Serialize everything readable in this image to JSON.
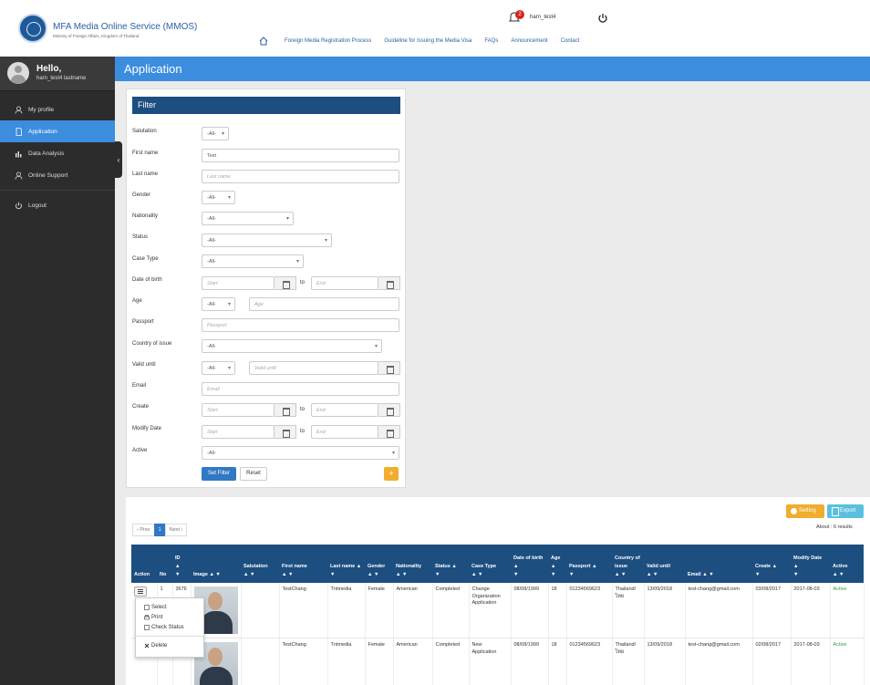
{
  "header": {
    "brand_title": "MFA Media Online Service (MMOS)",
    "brand_subtitle": "Ministry of Foreign Affairs, Kingdom of Thailand",
    "notification_count": "2",
    "username": "harn_test4",
    "nav": [
      "Foreign Media Registration Process",
      "Guideline for Issuing the Media Visa",
      "FAQs",
      "Announcement",
      "Contact"
    ]
  },
  "sidebar": {
    "hello": "Hello,",
    "user_fullname": "harn_test4 lastname",
    "items": [
      {
        "label": "My profile",
        "icon": "user-icon"
      },
      {
        "label": "Application",
        "icon": "document-icon"
      },
      {
        "label": "Data Analysis",
        "icon": "bar-chart-icon"
      },
      {
        "label": "Online Support",
        "icon": "support-icon"
      }
    ],
    "logout": "Logout"
  },
  "page_title": "Application",
  "filter": {
    "title": "Filter",
    "salutation": {
      "label": "Salutation",
      "value": "-All-"
    },
    "first_name": {
      "label": "First name",
      "value": "Test"
    },
    "last_name": {
      "label": "Last name",
      "placeholder": "Last name"
    },
    "gender": {
      "label": "Gender",
      "value": "-All-"
    },
    "nationality": {
      "label": "Nationality",
      "value": "-All-"
    },
    "status": {
      "label": "Status",
      "value": "-All-"
    },
    "case_type": {
      "label": "Case Type",
      "value": "-All-"
    },
    "dob": {
      "label": "Date of birth",
      "start": "Start",
      "to": "to",
      "end": "End"
    },
    "age": {
      "label": "Age",
      "op": "-All-",
      "placeholder": "Age"
    },
    "passport": {
      "label": "Passport",
      "placeholder": "Passport"
    },
    "country_issue": {
      "label": "Country of issue",
      "value": "-All-"
    },
    "valid_until": {
      "label": "Valid until",
      "op": "-All-",
      "placeholder": "Valid until"
    },
    "email": {
      "label": "Email",
      "placeholder": "Email"
    },
    "create": {
      "label": "Create",
      "start": "Start",
      "to": "to",
      "end": "End"
    },
    "modify_date": {
      "label": "Modify Date",
      "start": "Start",
      "to": "to",
      "end": "End"
    },
    "active": {
      "label": "Active",
      "value": "-All-"
    },
    "set_filter": "Set Filter",
    "reset": "Reset",
    "plus": "+"
  },
  "results": {
    "setting": "Setting",
    "export": "Export",
    "about": "About : 6 results",
    "pager": {
      "prev": "‹ Prev",
      "current": "1",
      "next": "Next ›"
    },
    "sort_marks": {
      "up": "▲",
      "down": "▼",
      "both": "▲ ▼"
    },
    "columns": {
      "action": "Action",
      "no": "No",
      "id": "ID",
      "image": "Image",
      "salutation": "Salutation",
      "first_name": "First name",
      "last_name": "Last name",
      "gender": "Gender",
      "nationality": "Nationality",
      "status": "Status",
      "case_type": "Case Type",
      "dob": "Date of birth",
      "age": "Age",
      "passport": "Passport",
      "country": "Country of issue",
      "valid_until": "Valid until",
      "email": "Email",
      "create": "Create",
      "modify": "Modify Date",
      "active": "Active"
    },
    "rows": [
      {
        "no": "1",
        "id": "3676",
        "salutation": "",
        "first_name": "TestChang",
        "last_name": "Tntmedia",
        "gender": "Female",
        "nationality": "American",
        "status": "Completed",
        "case_type": "Change Organization Application",
        "dob": "08/08/1999",
        "age": "18",
        "passport": "01234569623",
        "country": "Thailand/ ไทย",
        "valid_until": "13/09/2018",
        "email": "test-chang@gmail.com",
        "create": "03/08/2017",
        "modify": "2017-08-03",
        "active": "Active"
      },
      {
        "no": "",
        "id": "",
        "salutation": "",
        "first_name": "TestChang",
        "last_name": "Tntmedia",
        "gender": "Female",
        "nationality": "American",
        "status": "Completed",
        "case_type": "New Application",
        "dob": "08/08/1999",
        "age": "18",
        "passport": "01234569623",
        "country": "Thailand/ ไทย",
        "valid_until": "13/09/2018",
        "email": "test-chang@gmail.com",
        "create": "02/08/2017",
        "modify": "2017-08-03",
        "active": "Active"
      }
    ],
    "row_menu": {
      "select": "Select",
      "print": "Print",
      "check_status": "Check Status",
      "delete": "Delete"
    }
  },
  "colors": {
    "primary": "#3c8dde",
    "dark_blue": "#1c4e80",
    "sidebar": "#2c2c2c",
    "warning": "#f0ad2e",
    "info": "#5bc0de",
    "active_green": "#3a9a3a"
  }
}
